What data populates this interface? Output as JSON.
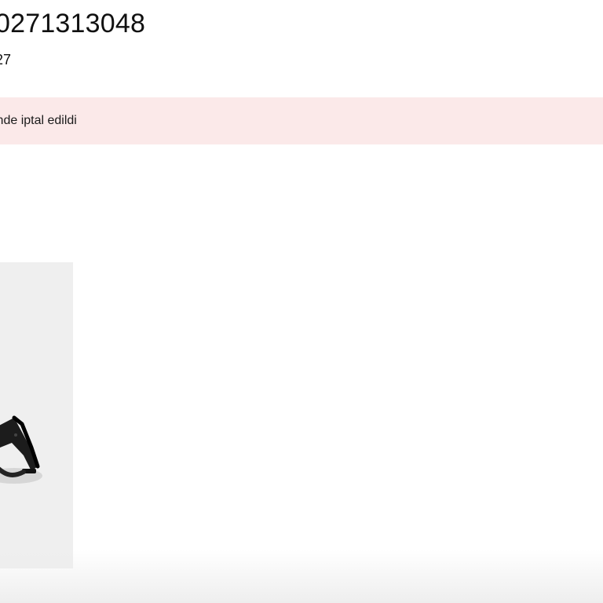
{
  "order": {
    "number": "0271313048",
    "date_fragment": "27"
  },
  "status_banner": {
    "text": "inde iptal edildi",
    "background_color": "#fbe9e9"
  },
  "product": {
    "image_name": "product-image",
    "card_background": "#efefef"
  }
}
